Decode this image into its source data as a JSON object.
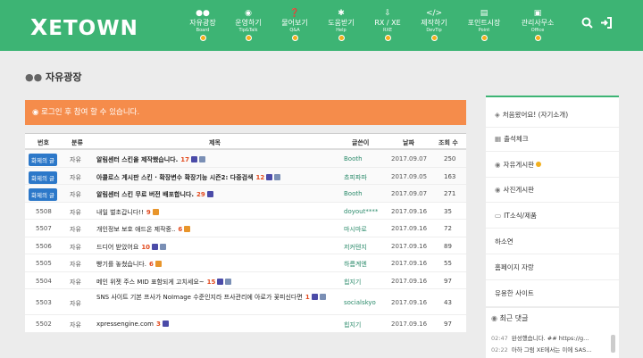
{
  "header": {
    "logo_mark": "X",
    "logo_text": "ETOWN",
    "nav": [
      {
        "label": "자유광장",
        "sub": "Board",
        "icon": "users-icon"
      },
      {
        "label": "운영하기",
        "sub": "Tip&Talk",
        "icon": "chat-icon"
      },
      {
        "label": "물어보기",
        "sub": "Q&A",
        "icon": "question-icon"
      },
      {
        "label": "도움받기",
        "sub": "Help",
        "icon": "help-icon"
      },
      {
        "label": "RX / XE",
        "sub": "RXE",
        "icon": "download-icon"
      },
      {
        "label": "제작하기",
        "sub": "DevTip",
        "icon": "code-icon"
      },
      {
        "label": "포인트시장",
        "sub": "Point",
        "icon": "cart-icon"
      },
      {
        "label": "관리사무소",
        "sub": "Office",
        "icon": "building-icon"
      }
    ]
  },
  "page": {
    "title": "자유광장",
    "notice": "로그인 후 참여 할 수 있습니다."
  },
  "table": {
    "headers": {
      "num": "번호",
      "cat": "분류",
      "title": "제목",
      "author": "글쓴이",
      "date": "날짜",
      "views": "조회 수"
    },
    "rows": [
      {
        "num": "화제의 글",
        "hot": true,
        "cat": "자유",
        "title": "알림센터 스킨을 제작했습니다.",
        "cnt": "17",
        "author": "Booth",
        "date": "2017.09.07",
        "views": "250"
      },
      {
        "num": "화제의 글",
        "hot": true,
        "cat": "자유",
        "title": "아콜로스 게시판 스킨 · 확장변수 확장기능 시즌2: 다중검색",
        "cnt": "12",
        "author": "쵸피파파",
        "date": "2017.09.05",
        "views": "163"
      },
      {
        "num": "화제의 글",
        "hot": true,
        "cat": "자유",
        "title": "알림센터 스킨 무료 버전 배포합니다.",
        "cnt": "29",
        "author": "Booth",
        "date": "2017.09.07",
        "views": "271"
      },
      {
        "num": "5508",
        "cat": "자유",
        "title": "내일 벌초갑니다!!",
        "cnt": "9",
        "author": "doyout****",
        "date": "2017.09.16",
        "views": "35"
      },
      {
        "num": "5507",
        "cat": "자유",
        "title": "개인정보 보호 애드온 제작중..",
        "cnt": "6",
        "author": "마시마로",
        "date": "2017.09.16",
        "views": "72"
      },
      {
        "num": "5506",
        "cat": "자유",
        "title": "드디어 받았어요",
        "cnt": "10",
        "author": "저커텐지",
        "date": "2017.09.16",
        "views": "89"
      },
      {
        "num": "5505",
        "cat": "자유",
        "title": "빵기를 놓쳤습니다.",
        "cnt": "6",
        "author": "하름계엔",
        "date": "2017.09.16",
        "views": "55"
      },
      {
        "num": "5504",
        "cat": "자유",
        "title": "메인 위젯 주스 MID 표함되게 고치세요~",
        "cnt": "15",
        "author": "힙지기",
        "date": "2017.09.16",
        "views": "97"
      },
      {
        "num": "5503",
        "cat": "자유",
        "title": "SNS 사이트 기본 프사가 NoImage 수준인지라 프사관리에 아로가 꽃피신다면",
        "cnt": "1",
        "author": "socialskyo",
        "date": "2017.09.16",
        "views": "43",
        "tall": true
      },
      {
        "num": "5502",
        "cat": "자유",
        "title": "xpressengine.com",
        "cnt": "3",
        "author": "힙지기",
        "date": "2017.09.16",
        "views": "97"
      }
    ]
  },
  "sidebar": {
    "items": [
      {
        "label": "처음왔어요! (자기소개)",
        "icon": "handshake-icon"
      },
      {
        "label": "출석체크",
        "icon": "calendar-icon"
      },
      {
        "label": "자유게시판",
        "icon": "chat-icon",
        "dot": true
      },
      {
        "label": "사진게시판",
        "icon": "camera-icon"
      },
      {
        "label": "IT소식/제품",
        "icon": "laptop-icon"
      },
      {
        "label": "하소연",
        "icon": ""
      },
      {
        "label": "홈페이지 자랑",
        "icon": ""
      },
      {
        "label": "유용한 사이트",
        "icon": ""
      }
    ]
  },
  "recent": {
    "title": "최근 댓글",
    "items": [
      {
        "time": "02:47",
        "text": "완성했습니다. ##  https://g..."
      },
      {
        "time": "02:22",
        "text": "아하 그럼 XE에서는 이에 SAS..."
      }
    ]
  },
  "colors": {
    "brand": "#3db474",
    "notice": "#f58c4b",
    "badge": "#2c78c9"
  }
}
